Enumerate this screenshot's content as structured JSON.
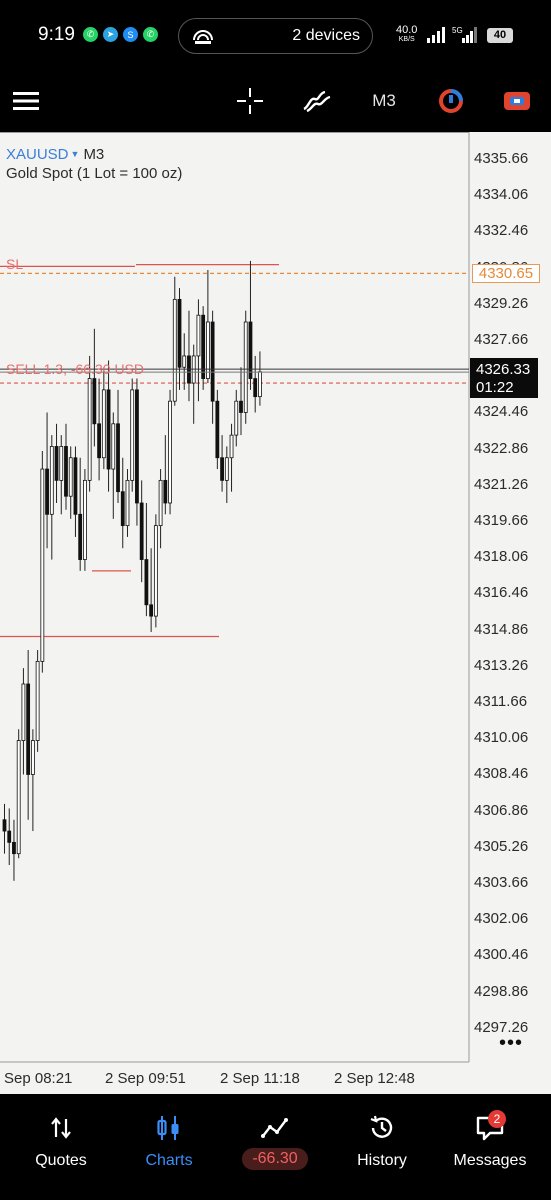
{
  "status_bar": {
    "time": "9:19",
    "devices": "2 devices",
    "net_speed": "40.0",
    "net_unit": "KB/S",
    "battery": "40"
  },
  "toolbar": {
    "timeframe": "M3",
    "icons": [
      "menu-icon",
      "crosshair-icon",
      "indicators-icon",
      "timeframe-button",
      "objects-icon",
      "trade-icon"
    ]
  },
  "chart_header": {
    "symbol": "XAUUSD",
    "timeframe": "M3",
    "description": "Gold Spot (1 Lot = 100 oz)"
  },
  "chart_data": {
    "type": "candlestick",
    "y_ticks": [
      "4335.66",
      "4334.06",
      "4332.46",
      "4330.86",
      "4329.26",
      "4327.66",
      "4326.06",
      "4324.46",
      "4322.86",
      "4321.26",
      "4319.66",
      "4318.06",
      "4316.46",
      "4314.86",
      "4313.26",
      "4311.66",
      "4310.06",
      "4308.46",
      "4306.86",
      "4305.26",
      "4303.66",
      "4302.06",
      "4300.46",
      "4298.86",
      "4297.26"
    ],
    "x_ticks": [
      "Sep 08:21",
      "2 Sep 09:51",
      "2 Sep 11:18",
      "2 Sep 12:48"
    ],
    "ylim": [
      4296.0,
      4337.0
    ],
    "sl_label": "SL",
    "sl_price": "4330.65",
    "sell_label": "SELL 1.3, -66.30 USD",
    "current_price": "4326.33",
    "countdown": "01:22",
    "candles": [
      [
        4306.5,
        4307.2,
        4305.0,
        4306.0
      ],
      [
        4306.0,
        4307.0,
        4304.5,
        4305.5
      ],
      [
        4305.5,
        4306.5,
        4303.8,
        4305.0
      ],
      [
        4305.0,
        4310.5,
        4304.8,
        4310.0
      ],
      [
        4310.0,
        4313.2,
        4308.5,
        4312.5
      ],
      [
        4312.5,
        4314.0,
        4306.5,
        4308.5
      ],
      [
        4308.5,
        4310.5,
        4306.0,
        4310.0
      ],
      [
        4310.0,
        4314.0,
        4309.5,
        4313.5
      ],
      [
        4313.5,
        4322.8,
        4313.0,
        4322.0
      ],
      [
        4322.0,
        4324.5,
        4318.5,
        4320.0
      ],
      [
        4320.0,
        4323.5,
        4318.0,
        4323.0
      ],
      [
        4323.0,
        4324.0,
        4320.5,
        4321.5
      ],
      [
        4321.5,
        4323.5,
        4320.0,
        4323.0
      ],
      [
        4323.0,
        4324.0,
        4320.2,
        4320.8
      ],
      [
        4320.8,
        4323.0,
        4319.8,
        4322.5
      ],
      [
        4322.5,
        4323.0,
        4319.0,
        4320.0
      ],
      [
        4320.0,
        4322.5,
        4317.5,
        4318.0
      ],
      [
        4318.0,
        4322.0,
        4317.5,
        4321.5
      ],
      [
        4321.5,
        4327.0,
        4321.0,
        4326.0
      ],
      [
        4326.0,
        4328.2,
        4323.0,
        4324.0
      ],
      [
        4324.0,
        4326.0,
        4321.5,
        4322.5
      ],
      [
        4322.5,
        4326.5,
        4322.0,
        4325.5
      ],
      [
        4325.5,
        4326.8,
        4321.0,
        4322.0
      ],
      [
        4322.0,
        4324.5,
        4319.8,
        4324.0
      ],
      [
        4324.0,
        4325.5,
        4320.5,
        4321.0
      ],
      [
        4321.0,
        4322.5,
        4318.5,
        4319.5
      ],
      [
        4319.5,
        4322.0,
        4319.0,
        4321.5
      ],
      [
        4321.5,
        4326.0,
        4321.0,
        4325.5
      ],
      [
        4325.5,
        4326.0,
        4319.5,
        4320.5
      ],
      [
        4320.5,
        4321.5,
        4317.0,
        4318.0
      ],
      [
        4318.0,
        4320.5,
        4315.5,
        4316.0
      ],
      [
        4316.0,
        4318.5,
        4314.8,
        4315.5
      ],
      [
        4315.5,
        4320.0,
        4315.0,
        4319.5
      ],
      [
        4319.5,
        4322.0,
        4318.5,
        4321.5
      ],
      [
        4321.5,
        4323.5,
        4320.0,
        4320.5
      ],
      [
        4320.5,
        4325.5,
        4320.0,
        4325.0
      ],
      [
        4325.0,
        4330.5,
        4324.8,
        4329.5
      ],
      [
        4329.5,
        4330.0,
        4325.5,
        4326.5
      ],
      [
        4326.5,
        4328.0,
        4325.5,
        4327.0
      ],
      [
        4327.0,
        4329.0,
        4325.0,
        4325.8
      ],
      [
        4325.8,
        4327.5,
        4324.0,
        4327.0
      ],
      [
        4327.0,
        4329.5,
        4325.0,
        4328.8
      ],
      [
        4328.8,
        4329.2,
        4325.5,
        4326.0
      ],
      [
        4326.0,
        4330.8,
        4325.8,
        4328.5
      ],
      [
        4328.5,
        4329.0,
        4324.0,
        4325.0
      ],
      [
        4325.0,
        4325.5,
        4322.0,
        4322.5
      ],
      [
        4322.5,
        4323.5,
        4321.0,
        4321.5
      ],
      [
        4321.5,
        4323.0,
        4320.5,
        4322.5
      ],
      [
        4322.5,
        4324.0,
        4321.0,
        4323.5
      ],
      [
        4323.5,
        4325.5,
        4323.0,
        4325.0
      ],
      [
        4325.0,
        4326.5,
        4323.5,
        4324.5
      ],
      [
        4324.5,
        4329.0,
        4324.0,
        4328.5
      ],
      [
        4328.5,
        4331.2,
        4325.5,
        4326.0
      ],
      [
        4326.0,
        4327.0,
        4324.5,
        4325.2
      ],
      [
        4325.2,
        4327.2,
        4324.8,
        4326.3
      ]
    ]
  },
  "bottom_nav": {
    "quotes": "Quotes",
    "charts": "Charts",
    "profit": "-66.30",
    "history": "History",
    "messages": "Messages",
    "messages_badge": "2"
  },
  "colors": {
    "accent": "#3a8ef6",
    "loss": "#e05050",
    "sl_orange": "#e48a3c",
    "chart_bg": "#f3f3f1"
  }
}
